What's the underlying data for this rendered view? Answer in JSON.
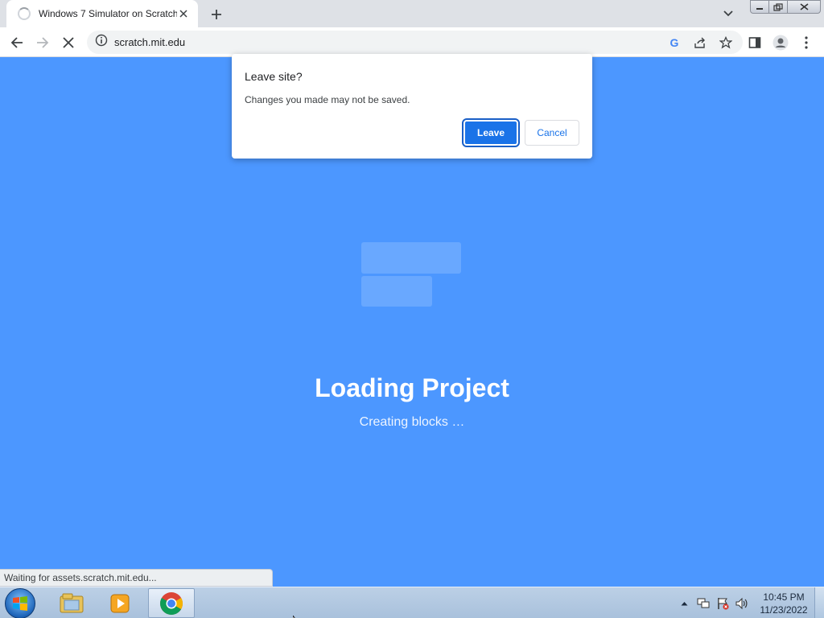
{
  "browser": {
    "tab": {
      "title": "Windows 7 Simulator on Scratch"
    },
    "address": {
      "url": "scratch.mit.edu"
    }
  },
  "page": {
    "loading_title": "Loading Project",
    "loading_status": "Creating blocks …"
  },
  "dialog": {
    "title": "Leave site?",
    "message": "Changes you made may not be saved.",
    "leave_label": "Leave",
    "cancel_label": "Cancel"
  },
  "status_bar": {
    "text": "Waiting for assets.scratch.mit.edu..."
  },
  "taskbar": {
    "time": "10:45 PM",
    "date": "11/23/2022"
  },
  "colors": {
    "page_background": "#4c97ff",
    "accent": "#1a73e8"
  }
}
